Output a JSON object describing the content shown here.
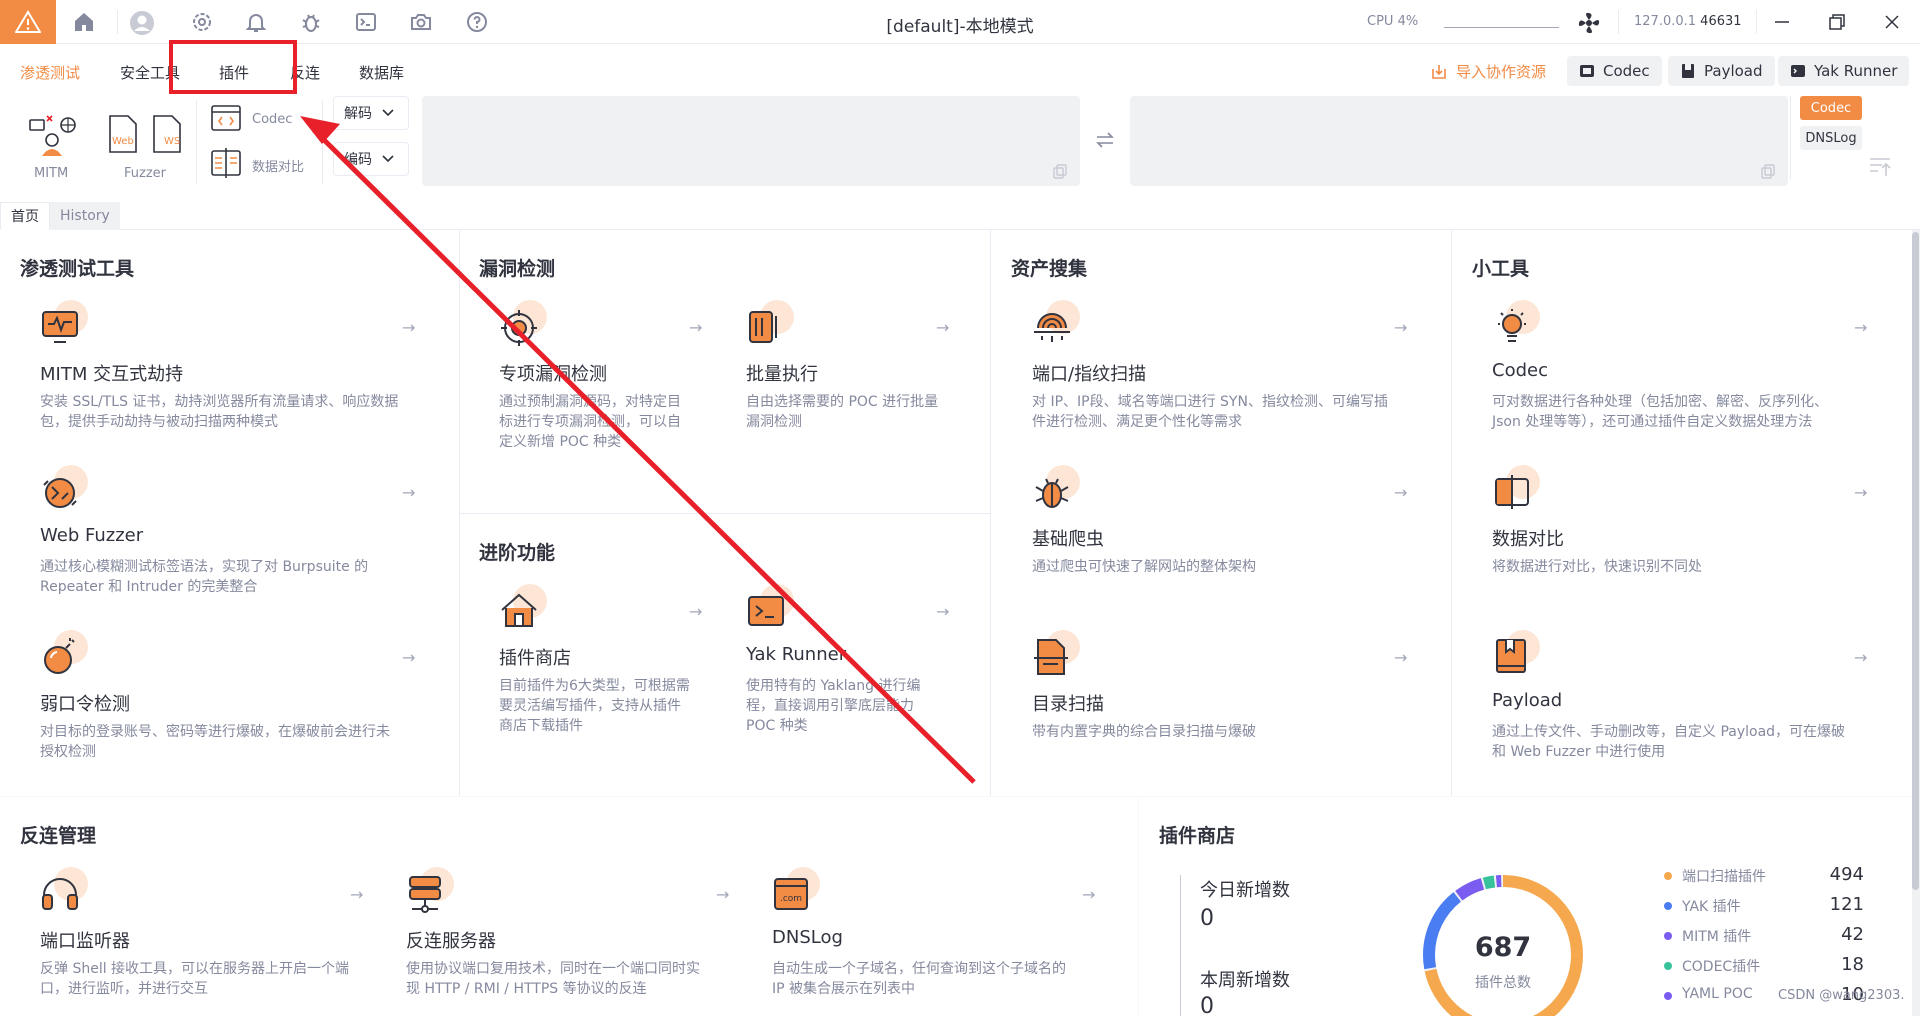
{
  "window": {
    "title": "[default]-本地模式",
    "cpu_label": "CPU 4%",
    "host_ip": "127.0.0.1",
    "host_port": "46631"
  },
  "menu": {
    "items": [
      "渗透测试",
      "安全工具",
      "插件",
      "反连",
      "数据库"
    ],
    "import_label": "导入协作资源",
    "right_buttons": [
      "Codec",
      "Payload",
      "Yak Runner"
    ]
  },
  "toolbar": {
    "mitm": "MITM",
    "fuzzer": "Fuzzer",
    "web_tag": "Web",
    "ws_tag": "WS",
    "codec": "Codec",
    "compare": "数据对比",
    "decode": "解码",
    "encode": "编码",
    "side_tags": [
      "Codec",
      "DNSLog"
    ]
  },
  "tabs": [
    "首页",
    "History"
  ],
  "sections": {
    "pentest": {
      "title": "渗透测试工具",
      "cards": [
        {
          "title": "MITM 交互式劫持",
          "desc": [
            "安装 SSL/TLS 证书，劫持浏览器所有流量请求、响应数据",
            "包，提供手动劫持与被动扫描两种模式"
          ]
        },
        {
          "title": "Web Fuzzer",
          "desc": [
            "通过核心模糊测试标签语法，实现了对 Burpsuite 的",
            "Repeater 和 Intruder 的完美整合"
          ]
        },
        {
          "title": "弱口令检测",
          "desc": [
            "对目标的登录账号、密码等进行爆破，在爆破前会进行未",
            "授权检测"
          ]
        }
      ]
    },
    "vuln": {
      "title": "漏洞检测",
      "cards": [
        {
          "title": "专项漏洞检测",
          "desc": [
            "通过预制漏洞源码，对特定目",
            "标进行专项漏洞检测，可以自",
            "定义新增 POC 种类"
          ]
        },
        {
          "title": "批量执行",
          "desc": [
            "自由选择需要的 POC 进行批量",
            "漏洞检测"
          ]
        }
      ]
    },
    "advanced": {
      "title": "进阶功能",
      "cards": [
        {
          "title": "插件商店",
          "desc": [
            "目前插件为6大类型，可根据需",
            "要灵活编写插件，支持从插件",
            "商店下载插件"
          ]
        },
        {
          "title": "Yak Runner",
          "desc": [
            "使用特有的 Yaklang 进行编",
            "程，直接调用引擎底层能力",
            "POC 种类"
          ]
        }
      ]
    },
    "asset": {
      "title": "资产搜集",
      "cards": [
        {
          "title": "端口/指纹扫描",
          "desc": [
            "对 IP、IP段、域名等端口进行 SYN、指纹检测、可编写插",
            "件进行检测、满足更个性化等需求"
          ]
        },
        {
          "title": "基础爬虫",
          "desc": [
            "通过爬虫可快速了解网站的整体架构"
          ]
        },
        {
          "title": "目录扫描",
          "desc": [
            "带有内置字典的综合目录扫描与爆破"
          ]
        }
      ]
    },
    "tools": {
      "title": "小工具",
      "cards": [
        {
          "title": "Codec",
          "desc": [
            "可对数据进行各种处理（包括加密、解密、反序列化、",
            "Json 处理等等），还可通过插件自定义数据处理方法"
          ]
        },
        {
          "title": "数据对比",
          "desc": [
            "将数据进行对比，快速识别不同处"
          ]
        },
        {
          "title": "Payload",
          "desc": [
            "通过上传文件、手动删改等，自定义 Payload，可在爆破",
            "和 Web Fuzzer 中进行使用"
          ]
        }
      ]
    },
    "reverse": {
      "title": "反连管理",
      "cards": [
        {
          "title": "端口监听器",
          "desc": [
            "反弹 Shell 接收工具，可以在服务器上开启一个端",
            "口，进行监听，并进行交互"
          ]
        },
        {
          "title": "反连服务器",
          "desc": [
            "使用协议端口复用技术，同时在一个端口同时实",
            "现 HTTP / RMI / HTTPS 等协议的反连"
          ]
        },
        {
          "title": "DNSLog",
          "desc": [
            "自动生成一个子域名，任何查询到这个子域名的",
            "IP 被集合展示在列表中"
          ]
        }
      ]
    },
    "store": {
      "title": "插件商店",
      "today_label": "今日新增数",
      "today_value": "0",
      "week_label": "本周新增数",
      "week_value": "0",
      "total_value": "687",
      "total_label": "插件总数",
      "legend": [
        {
          "name": "端口扫描插件",
          "value": "494",
          "color": "#f6a84e"
        },
        {
          "name": "YAK 插件",
          "value": "121",
          "color": "#4a7cf2"
        },
        {
          "name": "MITM 插件",
          "value": "42",
          "color": "#7b5cf0"
        },
        {
          "name": "CODEC插件",
          "value": "18",
          "color": "#36c29a"
        },
        {
          "name": "YAML POC",
          "value": "10",
          "color": "#7b5cf0"
        }
      ]
    }
  },
  "watermark": "CSDN @wang2303."
}
